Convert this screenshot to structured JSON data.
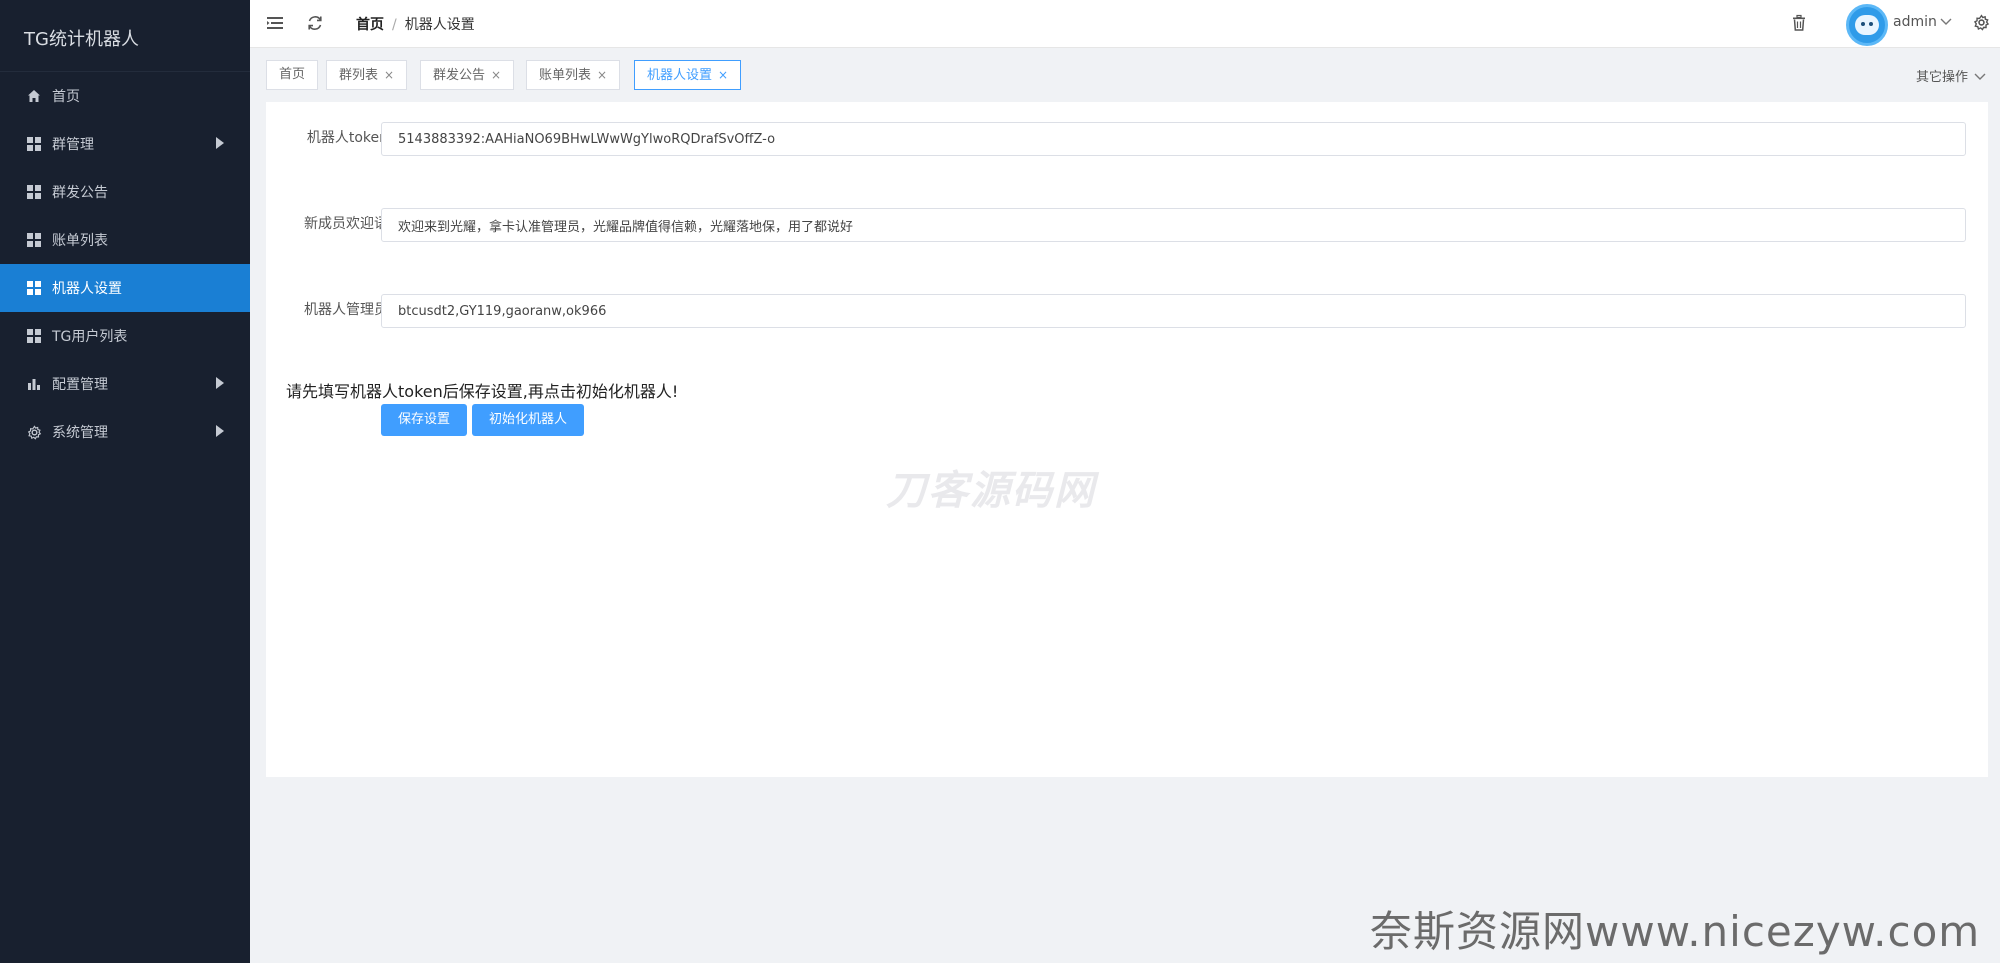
{
  "sidebar": {
    "brand": "TG统计机器人",
    "items": [
      {
        "label": "首页"
      },
      {
        "label": "群管理"
      },
      {
        "label": "群发公告"
      },
      {
        "label": "账单列表"
      },
      {
        "label": "机器人设置"
      },
      {
        "label": "TG用户列表"
      },
      {
        "label": "配置管理"
      },
      {
        "label": "系统管理"
      }
    ]
  },
  "header": {
    "breadcrumb_home": "首页",
    "breadcrumb_separator": "/",
    "breadcrumb_current": "机器人设置",
    "username": "admin"
  },
  "tabs": {
    "items": [
      {
        "label": "首页"
      },
      {
        "label": "群列表"
      },
      {
        "label": "群发公告"
      },
      {
        "label": "账单列表"
      },
      {
        "label": "机器人设置"
      }
    ],
    "close_glyph": "×",
    "more_label": "其它操作"
  },
  "form": {
    "token_label": "机器人token",
    "token_value": "5143883392:AAHiaNO69BHwLWwWgYlwoRQDrafSvOffZ-o",
    "welcome_label": "新成员欢迎语",
    "welcome_value": "欢迎来到光耀，拿卡认准管理员，光耀品牌值得信赖，光耀落地保，用了都说好",
    "admins_label": "机器人管理员",
    "admins_value": "btcusdt2,GY119,gaoranw,ok966",
    "notice": "请先填写机器人token后保存设置,再点击初始化机器人!",
    "save_button": "保存设置",
    "init_button": "初始化机器人"
  },
  "watermarks": {
    "center": "刀客源码网",
    "bottom": "奈斯资源网www.nicezyw.com"
  },
  "colors": {
    "sidebar_bg": "#18202f",
    "active_menu": "#1a7fd4",
    "primary": "#409eff"
  }
}
